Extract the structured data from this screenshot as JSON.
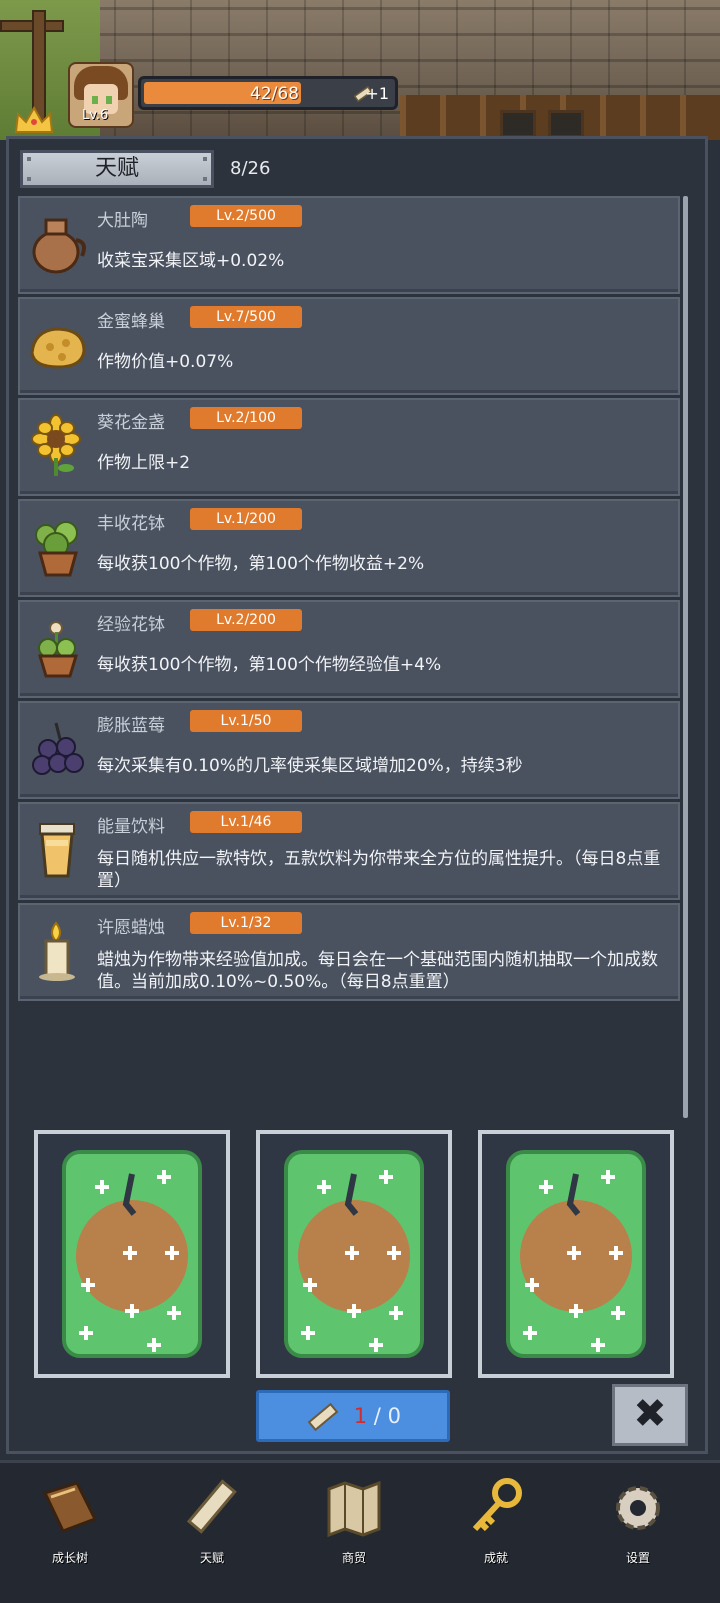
{
  "player": {
    "level": "Lv.6",
    "xp_text": "42/68",
    "xp_fraction": 0.62,
    "scroll_bonus": "+1"
  },
  "talent": {
    "title": "天赋",
    "count": "8/26"
  },
  "talents": [
    {
      "icon": "clay-jar-icon",
      "name": "大肚陶",
      "level": "Lv.2/500",
      "desc": "收菜宝采集区域+0.02%"
    },
    {
      "icon": "honeycomb-icon",
      "name": "金蜜蜂巢",
      "level": "Lv.7/500",
      "desc": "作物价值+0.07%"
    },
    {
      "icon": "sunflower-icon",
      "name": "葵花金盏",
      "level": "Lv.2/100",
      "desc": "作物上限+2"
    },
    {
      "icon": "flower-pot-icon",
      "name": "丰收花钵",
      "level": "Lv.1/200",
      "desc": "每收获100个作物，第100个作物收益+2%"
    },
    {
      "icon": "flower-pot-icon",
      "name": "经验花钵",
      "level": "Lv.2/200",
      "desc": "每收获100个作物，第100个作物经验值+4%"
    },
    {
      "icon": "blueberry-icon",
      "name": "膨胀蓝莓",
      "level": "Lv.1/50",
      "desc": "每次采集有0.10%的几率使采集区域增加20%，持续3秒"
    },
    {
      "icon": "drink-cup-icon",
      "name": "能量饮料",
      "level": "Lv.1/46",
      "desc": "每日随机供应一款特饮，五款饮料为你带来全方位的属性提升。（每日8点重置）"
    },
    {
      "icon": "candle-icon",
      "name": "许愿蜡烛",
      "level": "Lv.1/32",
      "desc": "蜡烛为作物带来经验值加成。每日会在一个基础范围内随机抽取一个加成数值。当前加成0.10%~0.50%。（每日8点重置）"
    }
  ],
  "draw": {
    "current": "1",
    "separator": " / ",
    "total": "0"
  },
  "close_label": "✖",
  "nav": [
    {
      "icon": "book-icon",
      "label": "成长树"
    },
    {
      "icon": "scroll-icon",
      "label": "天赋"
    },
    {
      "icon": "map-icon",
      "label": "商贸"
    },
    {
      "icon": "key-icon",
      "label": "成就"
    },
    {
      "icon": "gear-icon",
      "label": "设置"
    }
  ],
  "colors": {
    "badge": "#e07b2e",
    "draw_button": "#4c8fe0",
    "xp_fill": "#e98a3c"
  }
}
